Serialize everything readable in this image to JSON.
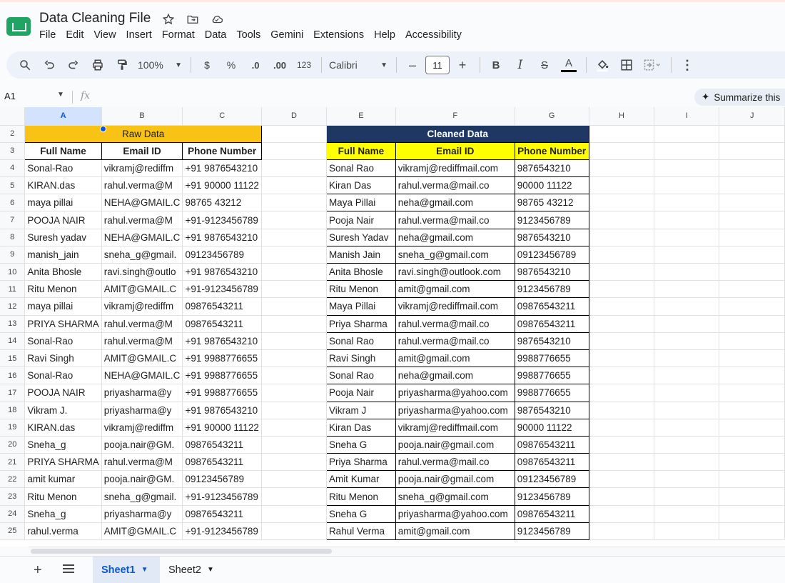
{
  "app": {
    "title": "Data Cleaning File",
    "menu": [
      "File",
      "Edit",
      "View",
      "Insert",
      "Format",
      "Data",
      "Tools",
      "Gemini",
      "Extensions",
      "Help",
      "Accessibility"
    ]
  },
  "toolbar": {
    "zoom": "100%",
    "currency": "$",
    "percent": "%",
    "dec_less": ".0",
    "dec_more": ".00",
    "format_123": "123",
    "font": "Calibri",
    "font_size": "11",
    "minus": "–",
    "plus": "+",
    "bold": "B",
    "italic": "I",
    "strike": "S",
    "text_color": "A",
    "more": "⋮"
  },
  "formula_bar": {
    "name_box": "A1",
    "fx": "fx",
    "summarize": "Summarize this"
  },
  "columns": [
    "A",
    "B",
    "C",
    "D",
    "E",
    "F",
    "G",
    "H",
    "I",
    "J"
  ],
  "raw": {
    "title": "Raw Data",
    "headers": [
      "Full Name",
      "Email ID",
      "Phone Number"
    ],
    "rows": [
      [
        "Sonal-Rao",
        "vikramj@rediffm",
        "+91 9876543210"
      ],
      [
        "KIRAN.das",
        "rahul.verma@M",
        "+91 90000 11122"
      ],
      [
        "maya pillai",
        "NEHA@GMAIL.C",
        " 98765 43212"
      ],
      [
        "POOJA NAIR",
        "rahul.verma@M",
        "+91-9123456789"
      ],
      [
        "Suresh  yadav",
        "NEHA@GMAIL.C",
        "+91 9876543210"
      ],
      [
        "manish_jain",
        "sneha_g@gmail.",
        "09123456789"
      ],
      [
        "Anita Bhosle",
        "ravi.singh@outlo",
        "+91 9876543210"
      ],
      [
        "Ritu  Menon",
        "AMIT@GMAIL.C",
        "+91-9123456789"
      ],
      [
        "maya pillai",
        "vikramj@rediffm",
        "09876543211"
      ],
      [
        "PRIYA SHARMA",
        "rahul.verma@M",
        "09876543211"
      ],
      [
        "Sonal-Rao",
        "rahul.verma@M",
        "+91 9876543210"
      ],
      [
        "Ravi Singh",
        "AMIT@GMAIL.C",
        "+91 9988776655"
      ],
      [
        "Sonal-Rao",
        "NEHA@GMAIL.C",
        "+91 9988776655"
      ],
      [
        "POOJA NAIR",
        " priyasharma@y",
        "+91 9988776655"
      ],
      [
        "Vikram J.",
        " priyasharma@y",
        "+91 9876543210"
      ],
      [
        "KIRAN.das",
        "vikramj@rediffm",
        "+91 90000 11122"
      ],
      [
        "Sneha_g",
        "pooja.nair@GM.",
        "09876543211"
      ],
      [
        "PRIYA SHARMA",
        "rahul.verma@M",
        "09876543211"
      ],
      [
        " amit kumar",
        "pooja.nair@GM.",
        "09123456789"
      ],
      [
        "Ritu  Menon",
        "sneha_g@gmail.",
        "+91-9123456789"
      ],
      [
        "Sneha_g",
        " priyasharma@y",
        "09876543211"
      ],
      [
        "rahul.verma",
        "AMIT@GMAIL.C",
        "+91-9123456789"
      ]
    ]
  },
  "clean": {
    "title": "Cleaned Data",
    "headers": [
      "Full Name",
      "Email ID",
      "Phone Number"
    ],
    "rows": [
      [
        "Sonal Rao",
        "vikramj@rediffmail.com",
        " 9876543210"
      ],
      [
        "Kiran Das",
        "rahul.verma@mail.co",
        " 90000 11122"
      ],
      [
        "Maya Pillai",
        "neha@gmail.com",
        "98765 43212"
      ],
      [
        "Pooja Nair",
        "rahul.verma@mail.co",
        "9123456789"
      ],
      [
        "Suresh Yadav",
        "neha@gmail.com",
        "9876543210"
      ],
      [
        "Manish Jain",
        "sneha_g@gmail.com",
        "09123456789"
      ],
      [
        "Anita Bhosle",
        "ravi.singh@outlook.com",
        "9876543210"
      ],
      [
        "Ritu Menon",
        "amit@gmail.com",
        "9123456789"
      ],
      [
        "Maya Pillai",
        "vikramj@rediffmail.com",
        "09876543211"
      ],
      [
        "Priya Sharma",
        "rahul.verma@mail.co",
        "09876543211"
      ],
      [
        "Sonal Rao",
        "rahul.verma@mail.co",
        "9876543210"
      ],
      [
        "Ravi Singh",
        "amit@gmail.com",
        "9988776655"
      ],
      [
        "Sonal Rao",
        "neha@gmail.com",
        "9988776655"
      ],
      [
        "Pooja Nair",
        "priyasharma@yahoo.com",
        "9988776655"
      ],
      [
        "Vikram J",
        "priyasharma@yahoo.com",
        "9876543210"
      ],
      [
        "Kiran Das",
        "vikramj@rediffmail.com",
        "90000 11122"
      ],
      [
        "Sneha G",
        "pooja.nair@gmail.com",
        "09876543211"
      ],
      [
        "Priya Sharma",
        "rahul.verma@mail.co",
        "09876543211"
      ],
      [
        "Amit Kumar",
        "pooja.nair@gmail.com",
        "09123456789"
      ],
      [
        "Ritu Menon",
        "sneha_g@gmail.com",
        "9123456789"
      ],
      [
        "Sneha G",
        "priyasharma@yahoo.com",
        "09876543211"
      ],
      [
        "Rahul Verma",
        "amit@gmail.com",
        "9123456789"
      ]
    ]
  },
  "row_numbers": [
    2,
    3,
    4,
    5,
    6,
    7,
    8,
    9,
    10,
    11,
    12,
    13,
    14,
    15,
    16,
    17,
    18,
    19,
    20,
    21,
    22,
    23,
    24,
    25
  ],
  "sheets": [
    "Sheet1",
    "Sheet2"
  ],
  "colors": {
    "raw_header": "#f9c315",
    "clean_header": "#1f3863",
    "clean_col_header": "#ffff00",
    "accent": "#0b57d0"
  }
}
